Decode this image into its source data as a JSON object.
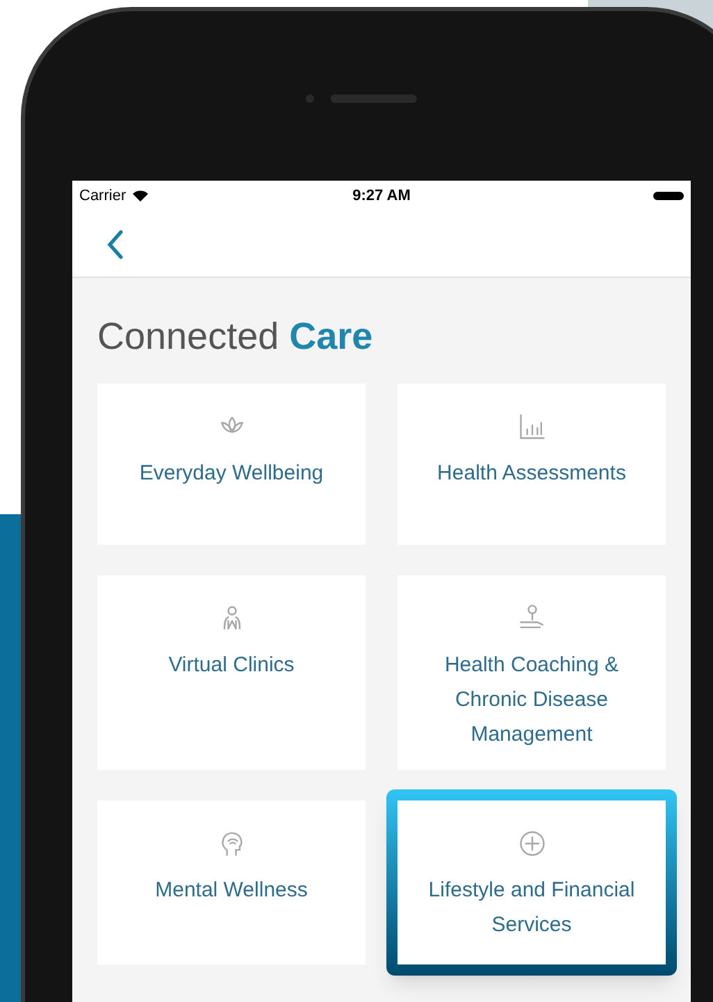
{
  "status_bar": {
    "carrier": "Carrier",
    "time": "9:27 AM"
  },
  "page_title": {
    "lead": "Connected",
    "accent": "Care"
  },
  "tiles": [
    {
      "label": "Everyday Wellbeing",
      "selected": false
    },
    {
      "label": "Health Assessments",
      "selected": false
    },
    {
      "label": "Virtual Clinics",
      "selected": false
    },
    {
      "label": "Health Coaching & Chronic Disease Management",
      "selected": false
    },
    {
      "label": "Mental Wellness",
      "selected": false
    },
    {
      "label": "Lifestyle and Financial Services",
      "selected": true
    }
  ]
}
